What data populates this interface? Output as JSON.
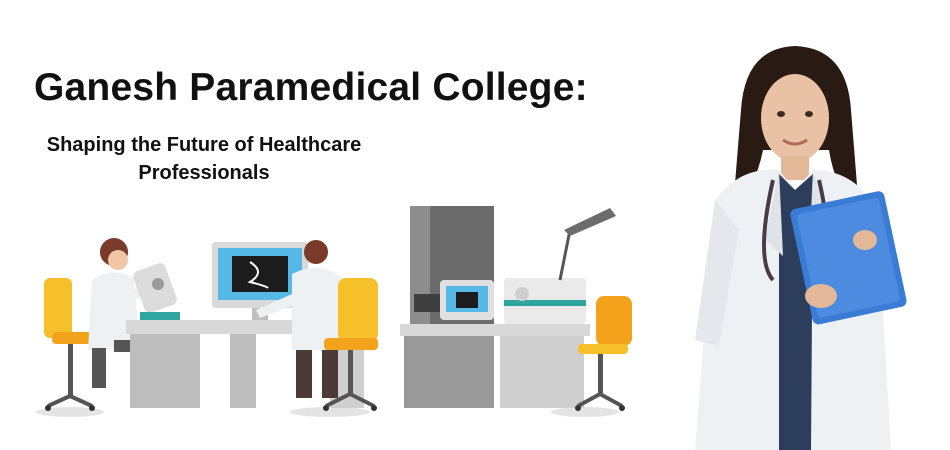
{
  "banner": {
    "title": "Ganesh Paramedical College:",
    "subtitle_line1": "Shaping the Future of Healthcare",
    "subtitle_line2": "Professionals"
  },
  "colors": {
    "text": "#111111",
    "chair_yellow": "#f6c02a",
    "chair_orange": "#f3a21b",
    "desk_gray": "#c8c8c8",
    "screen_blue": "#56b8e6",
    "coat_white": "#eef1f4",
    "folder_blue": "#3a7bd5"
  },
  "illustration": {
    "icon": "laboratory-illustration"
  },
  "photo": {
    "icon": "doctor-holding-folder-illustration"
  }
}
